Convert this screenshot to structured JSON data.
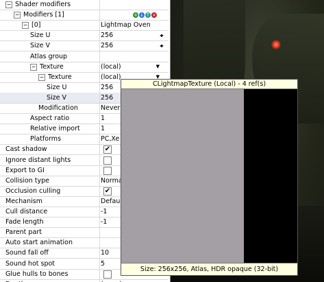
{
  "panel": {
    "rows": [
      {
        "label": "Shader modifiers",
        "indent": 0,
        "expander": "−",
        "value": ""
      },
      {
        "label": "Modifiers [1]",
        "indent": 1,
        "expander": "−",
        "value": ""
      },
      {
        "label": "[0]",
        "indent": 2,
        "expander": "−",
        "value": "Lightmap Oven"
      },
      {
        "label": "Size U",
        "indent": 3,
        "value": "256",
        "control": "spin"
      },
      {
        "label": "Size V",
        "indent": 3,
        "value": "256",
        "control": "spin"
      },
      {
        "label": "Atlas group",
        "indent": 3,
        "value": ""
      },
      {
        "label": "Texture",
        "indent": 3,
        "expander": "−",
        "value": "(local)",
        "control": "dropdown"
      },
      {
        "label": "Texture",
        "indent": 4,
        "expander": "−",
        "value": "(local)",
        "control": "dropdown"
      },
      {
        "label": "Size U",
        "indent": 5,
        "value": "256"
      },
      {
        "label": "Size V",
        "indent": 5,
        "value": "256",
        "selected": true
      },
      {
        "label": "Modification",
        "indent": 4,
        "value": "Never"
      },
      {
        "label": "Aspect ratio",
        "indent": 3,
        "value": "1"
      },
      {
        "label": "Relative import",
        "indent": 3,
        "value": "1"
      },
      {
        "label": "Platforms",
        "indent": 3,
        "value": "PC,Xe"
      },
      {
        "label": "Cast shadow",
        "indent": 0,
        "value": "",
        "control": "checkbox",
        "checked": true
      },
      {
        "label": "Ignore distant lights",
        "indent": 0,
        "value": "",
        "control": "checkbox",
        "checked": false
      },
      {
        "label": "Export to GI",
        "indent": 0,
        "value": "",
        "control": "checkbox",
        "checked": false
      },
      {
        "label": "Collision type",
        "indent": 0,
        "value": "Norma"
      },
      {
        "label": "Occlusion culling",
        "indent": 0,
        "value": "",
        "control": "checkbox",
        "checked": true
      },
      {
        "label": "Mechanism",
        "indent": 0,
        "value": "Defau"
      },
      {
        "label": "Cull distance",
        "indent": 0,
        "value": "-1"
      },
      {
        "label": "Fade length",
        "indent": 0,
        "value": "-1"
      },
      {
        "label": "Parent part",
        "indent": 0,
        "value": ""
      },
      {
        "label": "Auto start animation",
        "indent": 0,
        "value": ""
      },
      {
        "label": "Sound fall off",
        "indent": 0,
        "value": "10"
      },
      {
        "label": "Sound hot spot",
        "indent": 0,
        "value": "5"
      },
      {
        "label": "Glue hulls to bones",
        "indent": 0,
        "value": "",
        "control": "checkbox",
        "checked": false
      },
      {
        "label": "Death spawner",
        "indent": 0,
        "value": "(none)",
        "control": "dropdown"
      }
    ],
    "modifier_icons": [
      {
        "name": "add-icon",
        "glyph": "+",
        "color": "#2a9a2a"
      },
      {
        "name": "move-down-icon",
        "glyph": "↓",
        "color": "#2a6fd6"
      },
      {
        "name": "move-up-icon",
        "glyph": "↑",
        "color": "#2a9a9a"
      },
      {
        "name": "delete-icon",
        "glyph": "×",
        "color": "#c02020"
      }
    ]
  },
  "tooltip": {
    "title": "CLightmapTexture (Local) - 4 ref(s)",
    "footer": "Size: 256x256, Atlas, HDR opaque (32-bit)",
    "texture_color": "#a49ea5"
  }
}
